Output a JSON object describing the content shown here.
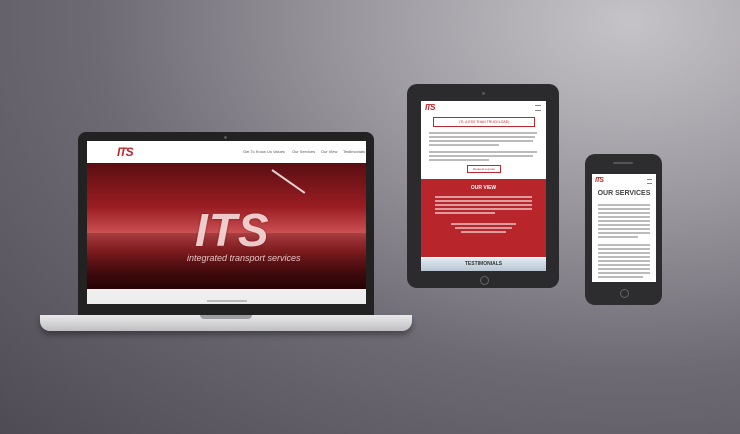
{
  "brand": {
    "logo": "ITS",
    "tagline": "integrated transport services",
    "accent": "#c0262b"
  },
  "laptop": {
    "nav": [
      "Get To Know Us",
      "Values",
      "Our Services",
      "Our View",
      "Testimonials"
    ],
    "hero": {
      "logo": "ITS",
      "tagline": "integrated transport services"
    }
  },
  "tablet": {
    "logo": "ITS",
    "banner": "LTL (LESS THAN TRUCKLOAD)",
    "button": "Request a quote",
    "our_view_title": "OUR VIEW",
    "testimonials_title": "TESTIMONIALS"
  },
  "phone": {
    "logo": "ITS",
    "section_title": "OUR SERVICES"
  },
  "colors": {
    "red": "#b8252b",
    "device": "#2b2b2d"
  }
}
